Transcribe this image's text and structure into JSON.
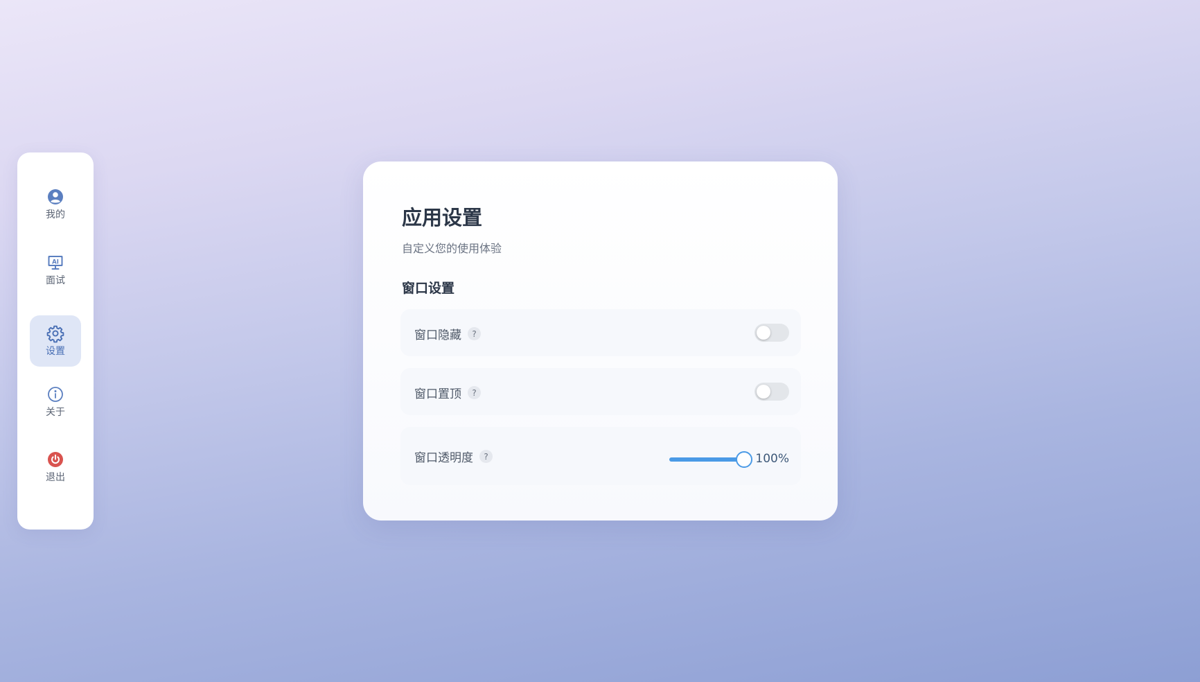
{
  "sidebar": {
    "items": [
      {
        "label": "我的",
        "icon": "user-circle-icon",
        "active": false
      },
      {
        "label": "面试",
        "icon": "ai-monitor-icon",
        "active": false
      },
      {
        "label": "设置",
        "icon": "gear-icon",
        "active": true
      },
      {
        "label": "关于",
        "icon": "info-icon",
        "active": false
      },
      {
        "label": "退出",
        "icon": "power-icon",
        "active": false
      }
    ]
  },
  "settings": {
    "title": "应用设置",
    "subtitle": "自定义您的使用体验",
    "section_title": "窗口设置",
    "help_glyph": "?",
    "rows": [
      {
        "label": "窗口隐藏",
        "type": "toggle",
        "on": false
      },
      {
        "label": "窗口置顶",
        "type": "toggle",
        "on": false
      },
      {
        "label": "窗口透明度",
        "type": "slider",
        "value": 1.0,
        "value_text": "100%"
      }
    ]
  },
  "colors": {
    "accent": "#4a9ae6",
    "active_nav_bg": "#dfe6f6",
    "nav_icon": "#5b7fc0",
    "exit_icon": "#d9534f",
    "title_text": "#2c3748"
  }
}
